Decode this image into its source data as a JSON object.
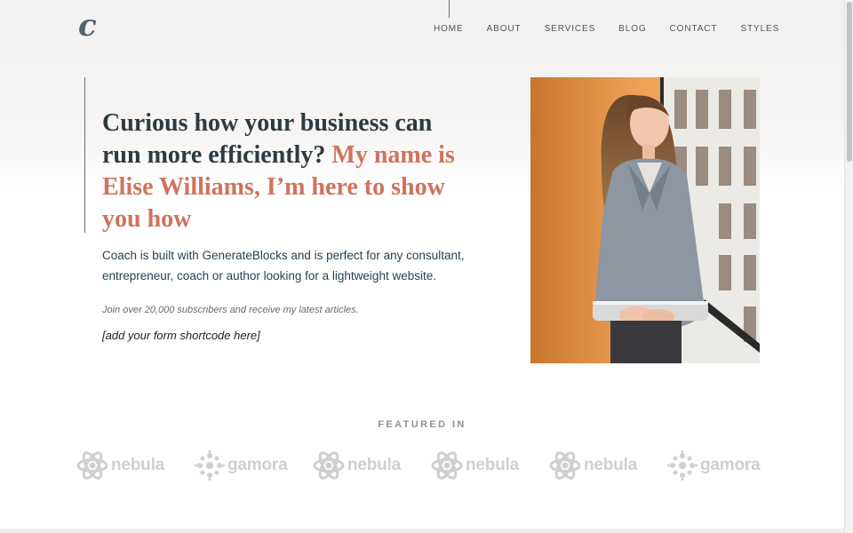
{
  "logo": {
    "letter": "c"
  },
  "nav": {
    "items": [
      {
        "label": "HOME"
      },
      {
        "label": "ABOUT"
      },
      {
        "label": "SERVICES"
      },
      {
        "label": "BLOG"
      },
      {
        "label": "CONTACT"
      },
      {
        "label": "STYLES"
      }
    ]
  },
  "hero": {
    "title_lead": "Curious how your business can run more efficiently?",
    "title_accent": "My name is Elise Williams, I’m here to show you how",
    "intro": "Coach is built with GenerateBlocks and is perfect for any consultant, entrepreneur, coach or author looking for a lightweight website.",
    "subscribe_text": "Join over 20,000 subscribers and receive my latest articles.",
    "form_placeholder": "[add your form shortcode here]",
    "photo_icon": "portrait-photo"
  },
  "featured": {
    "heading": "FEATURED IN",
    "logos": [
      {
        "name": "nebula",
        "icon": "atom-icon"
      },
      {
        "name": "gamora",
        "icon": "dots-icon"
      },
      {
        "name": "nebula",
        "icon": "atom-icon"
      },
      {
        "name": "nebula",
        "icon": "atom-icon"
      },
      {
        "name": "nebula",
        "icon": "atom-icon"
      },
      {
        "name": "gamora",
        "icon": "dots-icon"
      }
    ]
  },
  "colors": {
    "accent": "#d0735c",
    "text": "#2e3a41",
    "intro_text": "#274152",
    "logo_gray": "#cfcfcf"
  }
}
